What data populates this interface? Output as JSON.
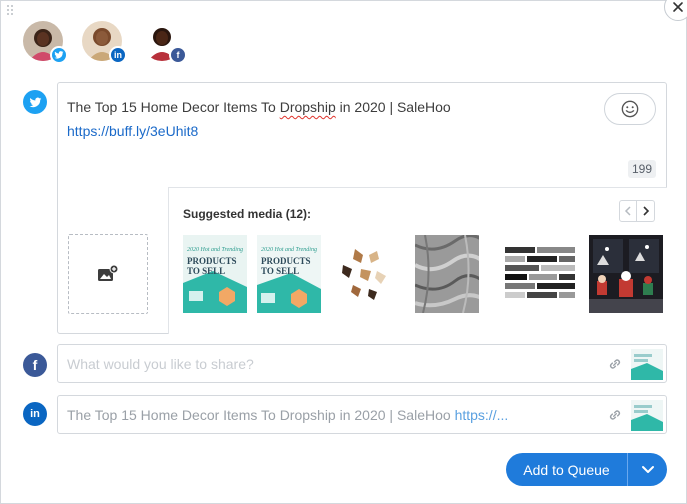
{
  "profiles": [
    {
      "network": "twitter",
      "badge_icon": "twitter-bird-icon",
      "badge_color": "#1da1f2"
    },
    {
      "network": "linkedin",
      "badge_icon": "linkedin-icon",
      "badge_color": "#0a66c2",
      "badge_text": "in"
    },
    {
      "network": "facebook",
      "badge_icon": "facebook-icon",
      "badge_color": "#3b5998",
      "badge_text": "f"
    }
  ],
  "twitter": {
    "post_text_before": "The Top 15 Home Decor Items To ",
    "post_text_misspelled": "Dropship",
    "post_text_after": " in 2020 | SaleHoo",
    "post_link": "https://buff.ly/3eUhit8",
    "char_count": "199",
    "emoji_icon": "smiley-face-icon",
    "upload_icon": "add-image-icon",
    "suggested_media_label": "Suggested media (12):",
    "thumbnails": [
      {
        "name": "products-to-sell-graphic-1",
        "line1": "2020 Hot and Trending",
        "line2": "PRODUCTS",
        "line3": "TO SELL"
      },
      {
        "name": "products-to-sell-graphic-2",
        "line1": "2020 Hot and Trending",
        "line2": "PRODUCTS",
        "line3": "TO SELL"
      },
      {
        "name": "butterfly-wall-decor"
      },
      {
        "name": "marble-texture"
      },
      {
        "name": "subway-tile-pattern"
      },
      {
        "name": "christmas-window-decor"
      }
    ]
  },
  "facebook": {
    "placeholder": "What would you like to share?",
    "network_icon": "facebook-icon",
    "icon_color": "#3b5998",
    "icon_text": "f"
  },
  "linkedin": {
    "text": "The Top 15 Home Decor Items To Dropship in 2020 | SaleHoo ",
    "link": "https://...",
    "network_icon": "linkedin-icon",
    "icon_color": "#0a66c2",
    "icon_text": "in"
  },
  "twitter_icon_color": "#1da1f2",
  "actions": {
    "add_to_queue": "Add to Queue"
  },
  "colors": {
    "primary": "#1f7bdb",
    "thumb_teal": "#2fb8a8"
  }
}
